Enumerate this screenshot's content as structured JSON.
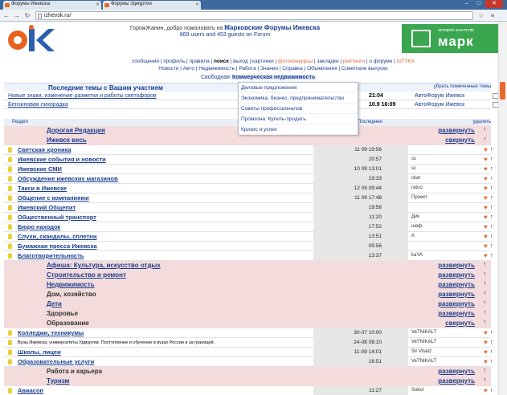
{
  "browser": {
    "tabs": [
      {
        "title": "Форумы Ижевска"
      },
      {
        "title": "Форумы Удмуртии"
      }
    ],
    "url": "izhevsk.ru/"
  },
  "header": {
    "greeting": "ГорожЖанин, добро пожаловать на",
    "brand": "Марковские Форумы Ижевска",
    "online": "869 users and 453 guests on Forum",
    "banner_small": "интернет-агентство",
    "banner": "марк"
  },
  "topnav": [
    {
      "label": "сообщения"
    },
    {
      "label": "профиль"
    },
    {
      "label": "правила"
    },
    {
      "label": "поиск",
      "bold": true
    },
    {
      "label": "выход"
    },
    {
      "label": "картинки"
    },
    {
      "label": "фотоконкурсы",
      "hl": true
    },
    {
      "label": "закладки"
    },
    {
      "label": "рейтинги",
      "hl": true
    },
    {
      "label": "о форуме"
    },
    {
      "label": "ШТУКА",
      "hl": true
    }
  ],
  "subnav": [
    "Новости",
    "Авто",
    "Недвижимость",
    "Работа",
    "Знания",
    "Справка",
    "Объявления",
    "Советские выпуски"
  ],
  "subnav2": {
    "left": "Свободная",
    "active": "Коммерческая недвижимость"
  },
  "dropdown": [
    "Деловые предложения",
    "Экономика, бизнес, предпринимательство",
    "Советы профессионалов",
    "Промзона: Купить-продать",
    "Кризис и успех"
  ],
  "recent": {
    "title": "Последние темы с Вашим участием",
    "right": "убрать помеченные темы",
    "rows": [
      {
        "name": "Новые знаки, изменение разметки и работы светофоров",
        "date": "21:04",
        "author": "АвтоФорум Ижевск"
      },
      {
        "name": "Бензиновая лихорадка",
        "date": "10.9 16:09",
        "author": "АвтоФорум Ижевск"
      }
    ]
  },
  "table_head": {
    "left": "Раздел",
    "mid": "Последнее",
    "right": "удалить"
  },
  "rows": [
    {
      "kind": "sect",
      "title": "Дорогая Редакция",
      "toggle": "развернуть",
      "arrow": "↑"
    },
    {
      "kind": "sect",
      "title": "Ижевск весь",
      "toggle": "свернуть",
      "arrow": "↑"
    },
    {
      "kind": "row",
      "name": "Светская хроника",
      "time": "11 09 19:56",
      "author": "",
      "arrow": "↑"
    },
    {
      "kind": "row",
      "name": "Ижевские события и новости",
      "time": "20:57",
      "author": "sc",
      "arrow": "↑"
    },
    {
      "kind": "row",
      "name": "Ижевские СМИ",
      "time": "10 09 13:01",
      "author": "sc",
      "arrow": "↑"
    },
    {
      "kind": "row",
      "name": "Обсуждение ижевских магазинов",
      "time": "19:33",
      "author": "ckar",
      "arrow": "↑"
    },
    {
      "kind": "row",
      "name": "Такси в Ижевске",
      "time": "12 09 09:44",
      "author": "ratuo",
      "arrow": "↑"
    },
    {
      "kind": "row",
      "name": "Общение с компаниями",
      "time": "11 09 17:48",
      "author": "Проект",
      "arrow": "↑"
    },
    {
      "kind": "row",
      "name": "Ижевский Общепит",
      "time": "19:58",
      "author": "",
      "arrow": "↑"
    },
    {
      "kind": "row",
      "name": "Общественный транспорт",
      "time": "11:20",
      "author": "Дик",
      "arrow": "↑"
    },
    {
      "kind": "row",
      "name": "Бюро находок",
      "time": "17:52",
      "author": "шеф",
      "arrow": "↑"
    },
    {
      "kind": "row",
      "name": "Слухи, скандалы, сплетни",
      "time": "13:51",
      "author": "A",
      "arrow": "↑"
    },
    {
      "kind": "row",
      "name": "Бумажная пресса Ижевска",
      "time": "05:56",
      "author": "",
      "arrow": "↑"
    },
    {
      "kind": "row",
      "name": "Благотворительность",
      "time": "13:37",
      "author": "kaYA",
      "arrow": "↑"
    },
    {
      "kind": "sect",
      "title": "Афиша: Культура, искусство отдых",
      "toggle": "развернуть",
      "arrow": "↑"
    },
    {
      "kind": "sect",
      "title": "Строительство и ремонт",
      "toggle": "развернуть",
      "arrow": "↑"
    },
    {
      "kind": "sect",
      "title": "Недвижимость",
      "toggle": "развернуть",
      "arrow": "↑"
    },
    {
      "kind": "sect",
      "title": "Дом, хозяйство",
      "toggle": "развернуть",
      "arrow": "↑",
      "plain": true
    },
    {
      "kind": "sect",
      "title": "Дети",
      "toggle": "развернуть",
      "arrow": "↑"
    },
    {
      "kind": "sect",
      "title": "Здоровье",
      "toggle": "развернуть",
      "arrow": "↑",
      "plain": true
    },
    {
      "kind": "sect",
      "title": "Образование",
      "toggle": "свернуть",
      "arrow": "↑",
      "plain": true
    },
    {
      "kind": "row",
      "name": "Колледжи, техникумы",
      "time": "30-07 10:00",
      "author": "VeTNIKALT",
      "arrow": "↑"
    },
    {
      "kind": "row",
      "name": "Вузы Ижевска, университеты Удмуртии. Поступление и обучение в вузах России и за границей.",
      "time": "24-08 08:10",
      "author": "VeTNIKALT",
      "arrow": "↑",
      "small": true
    },
    {
      "kind": "row",
      "name": "Школы, лицеи",
      "time": "11-09 14:01",
      "author": "Sir Vitali2",
      "arrow": "↑"
    },
    {
      "kind": "row",
      "name": "Образовательные услуги",
      "time": "16:51",
      "author": "VeTNIKALT",
      "arrow": "↑"
    },
    {
      "kind": "sect",
      "title": "Работа и карьера",
      "toggle": "развернуть",
      "arrow": "↑",
      "plain": true
    },
    {
      "kind": "sect",
      "title": "Туризм",
      "toggle": "развернуть",
      "arrow": "↑"
    },
    {
      "kind": "row",
      "name": "Авиасоп",
      "time": "11:27",
      "author": "Sokol",
      "arrow": "↑"
    }
  ]
}
